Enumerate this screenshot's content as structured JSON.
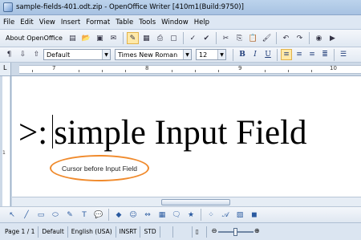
{
  "window": {
    "title": "sample-fields-401.odt.zip - OpenOffice Writer [410m1(Build:9750)]"
  },
  "menu": [
    "File",
    "Edit",
    "View",
    "Insert",
    "Format",
    "Table",
    "Tools",
    "Window",
    "Help"
  ],
  "toolbar": {
    "about_label": "About OpenOffice"
  },
  "formatting": {
    "style": "Default",
    "font": "Times New Roman",
    "size": "12"
  },
  "ruler": {
    "numbers": [
      "7",
      "8",
      "9",
      "10"
    ],
    "vertical_numbers": [
      "1"
    ]
  },
  "document": {
    "prefix": ">:",
    "field_text": "simple Input Field"
  },
  "annotation": {
    "text": "Cursor before Input Field",
    "color": "#f08a2c"
  },
  "status": {
    "page": "Page 1 / 1",
    "style": "Default",
    "language": "English (USA)",
    "mode": "INSRT",
    "selection": "STD",
    "zoom_fraction": 0.5
  }
}
